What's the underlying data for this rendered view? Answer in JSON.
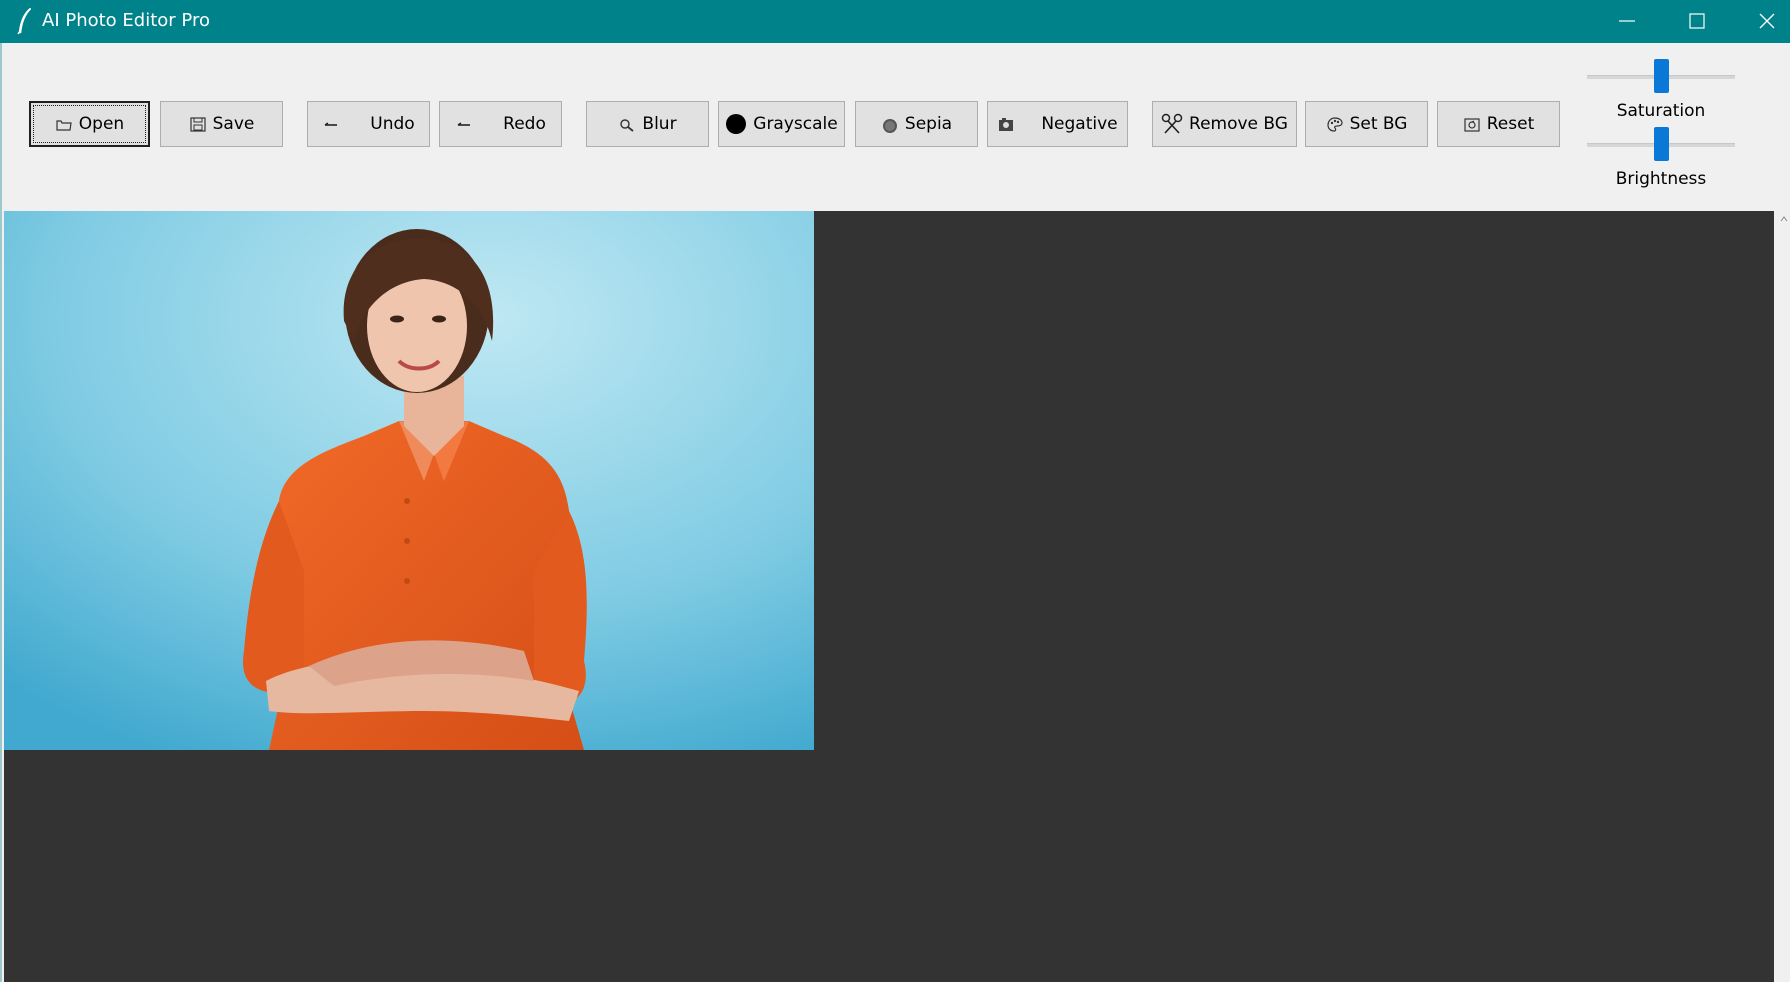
{
  "window": {
    "title": "AI Photo Editor Pro",
    "app_icon": "feather-icon",
    "controls": [
      "minimize-icon",
      "maximize-icon",
      "close-icon"
    ],
    "titlebar_color": "#00828a"
  },
  "toolbar": {
    "open": {
      "label": "Open",
      "icon": "folder-icon"
    },
    "save": {
      "label": "Save",
      "icon": "floppy-icon"
    },
    "undo": {
      "label": "Undo",
      "icon": "undo-arrow-icon"
    },
    "redo": {
      "label": "Redo",
      "icon": "redo-arrow-icon"
    },
    "blur": {
      "label": "Blur",
      "icon": "magnifier-icon"
    },
    "grayscale": {
      "label": "Grayscale",
      "icon": "black-circle-icon"
    },
    "sepia": {
      "label": "Sepia",
      "icon": "sepia-circle-icon"
    },
    "negative": {
      "label": "Negative",
      "icon": "camera-icon"
    },
    "remove_bg": {
      "label": "Remove BG",
      "icon": "scissors-icon"
    },
    "set_bg": {
      "label": "Set BG",
      "icon": "palette-icon"
    },
    "reset": {
      "label": "Reset",
      "icon": "reset-icon"
    }
  },
  "adjustments": {
    "saturation": {
      "label": "Saturation",
      "value_fraction": 0.5
    },
    "brightness": {
      "label": "Brightness",
      "value_fraction": 0.5
    },
    "accent_color": "#0a78d7"
  },
  "canvas": {
    "background_color": "#333333",
    "image": {
      "description_icon": "portrait-photo",
      "background_color": "#6cc6e0",
      "subject_shirt_color": "#e55a1c"
    }
  }
}
